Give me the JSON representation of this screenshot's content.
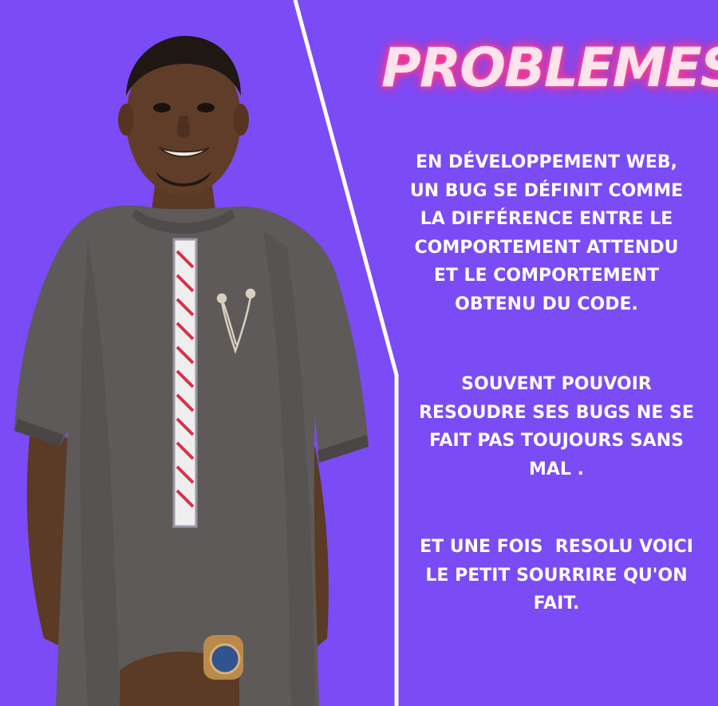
{
  "colors": {
    "background": "#7b4bf5",
    "title_glow": "#ff3d8f",
    "title_fill": "#ffe3ec",
    "text": "#ffffff",
    "divider": "#ffffff"
  },
  "title": "PROBLEMES!",
  "paragraphs": [
    {
      "lines": [
        "EN DÉVELOPPEMENT WEB,",
        "UN BUG SE DÉFINIT COMME",
        "LA DIFFÉRENCE ENTRE LE",
        "COMPORTEMENT ATTENDU",
        "ET LE COMPORTEMENT",
        "OBTENU DU CODE."
      ]
    },
    {
      "lines": [
        "SOUVENT POUVOIR",
        "RESOUDRE SES BUGS NE SE",
        "FAIT PAS TOUJOURS SANS",
        "MAL ."
      ]
    },
    {
      "lines": [
        "ET UNE FOIS  RESOLU VOICI",
        "LE PETIT SOURRIRE QU'ON",
        "FAIT."
      ]
    }
  ]
}
